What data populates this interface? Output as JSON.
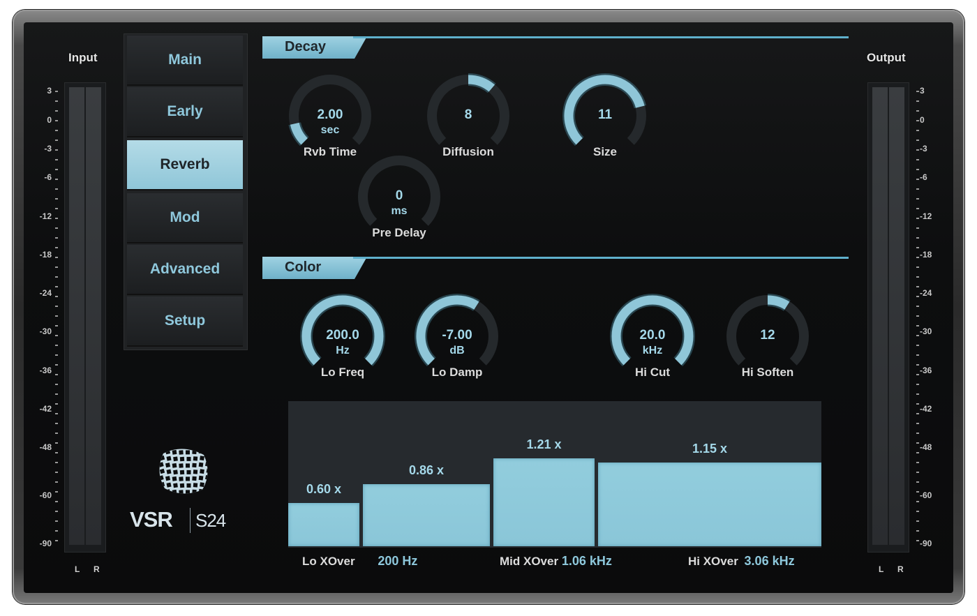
{
  "app": {
    "brand": "VSR",
    "model": "S24",
    "logo_icon": "mesh-cube-logo"
  },
  "input_meter": {
    "title": "Input",
    "channels": [
      "L",
      "R"
    ],
    "scale": [
      "3",
      "0",
      "-3",
      "-6",
      "-12",
      "-18",
      "-24",
      "-30",
      "-36",
      "-42",
      "-48",
      "-60",
      "-90"
    ]
  },
  "output_meter": {
    "title": "Output",
    "channels": [
      "L",
      "R"
    ],
    "scale": [
      "3",
      "0",
      "-3",
      "-6",
      "-12",
      "-18",
      "-24",
      "-30",
      "-36",
      "-42",
      "-48",
      "-60",
      "-90"
    ]
  },
  "tabs": [
    {
      "label": "Main",
      "active": false
    },
    {
      "label": "Early",
      "active": false
    },
    {
      "label": "Reverb",
      "active": true
    },
    {
      "label": "Mod",
      "active": false
    },
    {
      "label": "Advanced",
      "active": false
    },
    {
      "label": "Setup",
      "active": false
    }
  ],
  "decay": {
    "title": "Decay",
    "knobs": [
      {
        "id": "rvb-time",
        "label": "Rvb Time",
        "value": "2.00",
        "unit": "sec",
        "fill": 0.12
      },
      {
        "id": "diffusion",
        "label": "Diffusion",
        "value": "8",
        "unit": "",
        "fill": 0.5,
        "fill_start": 0.5,
        "fill_end": 0.65
      },
      {
        "id": "size",
        "label": "Size",
        "value": "11",
        "unit": "",
        "fill": 0.78
      },
      {
        "id": "pre-delay",
        "label": "Pre Delay",
        "value": "0",
        "unit": "ms",
        "fill": 0.0
      }
    ]
  },
  "color": {
    "title": "Color",
    "knobs": [
      {
        "id": "lo-freq",
        "label": "Lo Freq",
        "value": "200.0",
        "unit": "Hz",
        "fill": 1.0
      },
      {
        "id": "lo-damp",
        "label": "Lo Damp",
        "value": "-7.00",
        "unit": "dB",
        "fill": 0.62
      },
      {
        "id": "hi-cut",
        "label": "Hi Cut",
        "value": "20.0",
        "unit": "kHz",
        "fill": 1.0
      },
      {
        "id": "hi-soften",
        "label": "Hi Soften",
        "value": "12",
        "unit": "",
        "fill": 0.62,
        "fill_start": 0.5,
        "fill_end": 0.62
      }
    ]
  },
  "bands": [
    {
      "label": "0.60 x",
      "value": 0.6
    },
    {
      "label": "0.86 x",
      "value": 0.86
    },
    {
      "label": "1.21 x",
      "value": 1.21
    },
    {
      "label": "1.15 x",
      "value": 1.15
    }
  ],
  "crossovers": [
    {
      "name": "Lo XOver",
      "value": "200 Hz"
    },
    {
      "name": "Mid XOver",
      "value": "1.06 kHz"
    },
    {
      "name": "Hi XOver",
      "value": "3.06 kHz"
    }
  ],
  "colors": {
    "accent": "#8fc6d8",
    "track": "#25292c",
    "panel": "#121314"
  }
}
